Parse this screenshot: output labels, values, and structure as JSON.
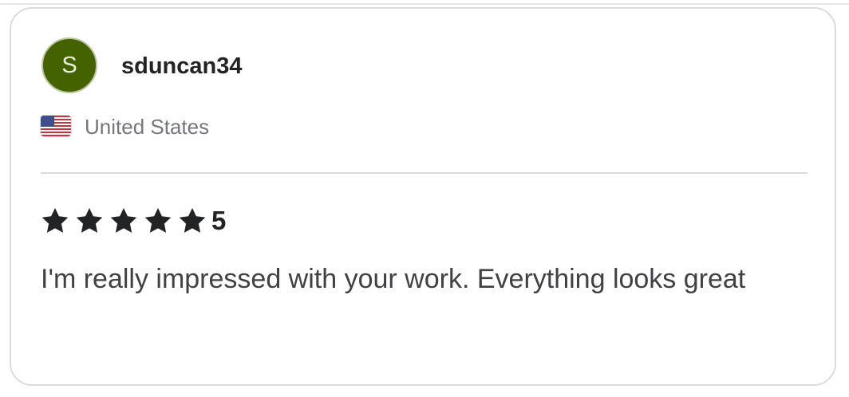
{
  "review": {
    "avatar_initial": "S",
    "username": "sduncan34",
    "country": "United States",
    "flag_icon": "us-flag-icon",
    "rating_value": "5",
    "stars": 5,
    "text": "I'm really impressed with your work. Everything looks great"
  },
  "colors": {
    "avatar_bg": "#456200",
    "star": "#222325",
    "text": "#404145",
    "muted": "#74767e"
  }
}
